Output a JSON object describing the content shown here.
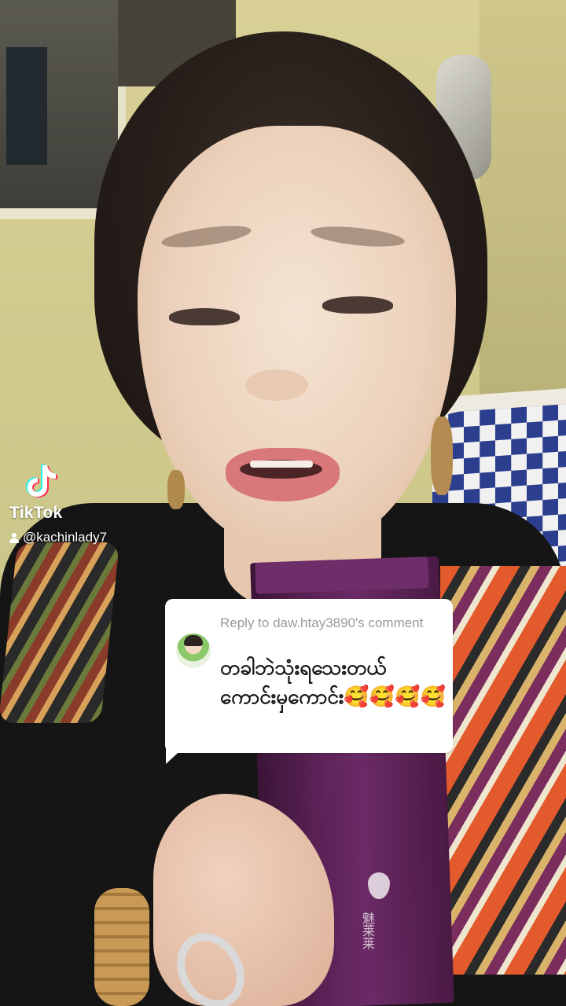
{
  "watermark": {
    "brand": "TikTok",
    "username": "@kachinlady7",
    "logo_icon": "tiktok-note-icon",
    "user_icon": "person-icon"
  },
  "reply": {
    "header": "Reply to daw.htay3890's comment",
    "text": "တခါဘဲသုံးရသေးတယ် ကောင်းမှကောင်း🥰🥰🥰🥰",
    "avatar_icon": "commenter-avatar"
  },
  "product": {
    "brand_chars": "魅莱莱"
  },
  "colors": {
    "bubble_bg": "#ffffff",
    "header_text": "#9a9a9a",
    "reply_text": "#161616",
    "tiktok_cyan": "#25f4ee",
    "tiktok_red": "#fe2c55"
  }
}
